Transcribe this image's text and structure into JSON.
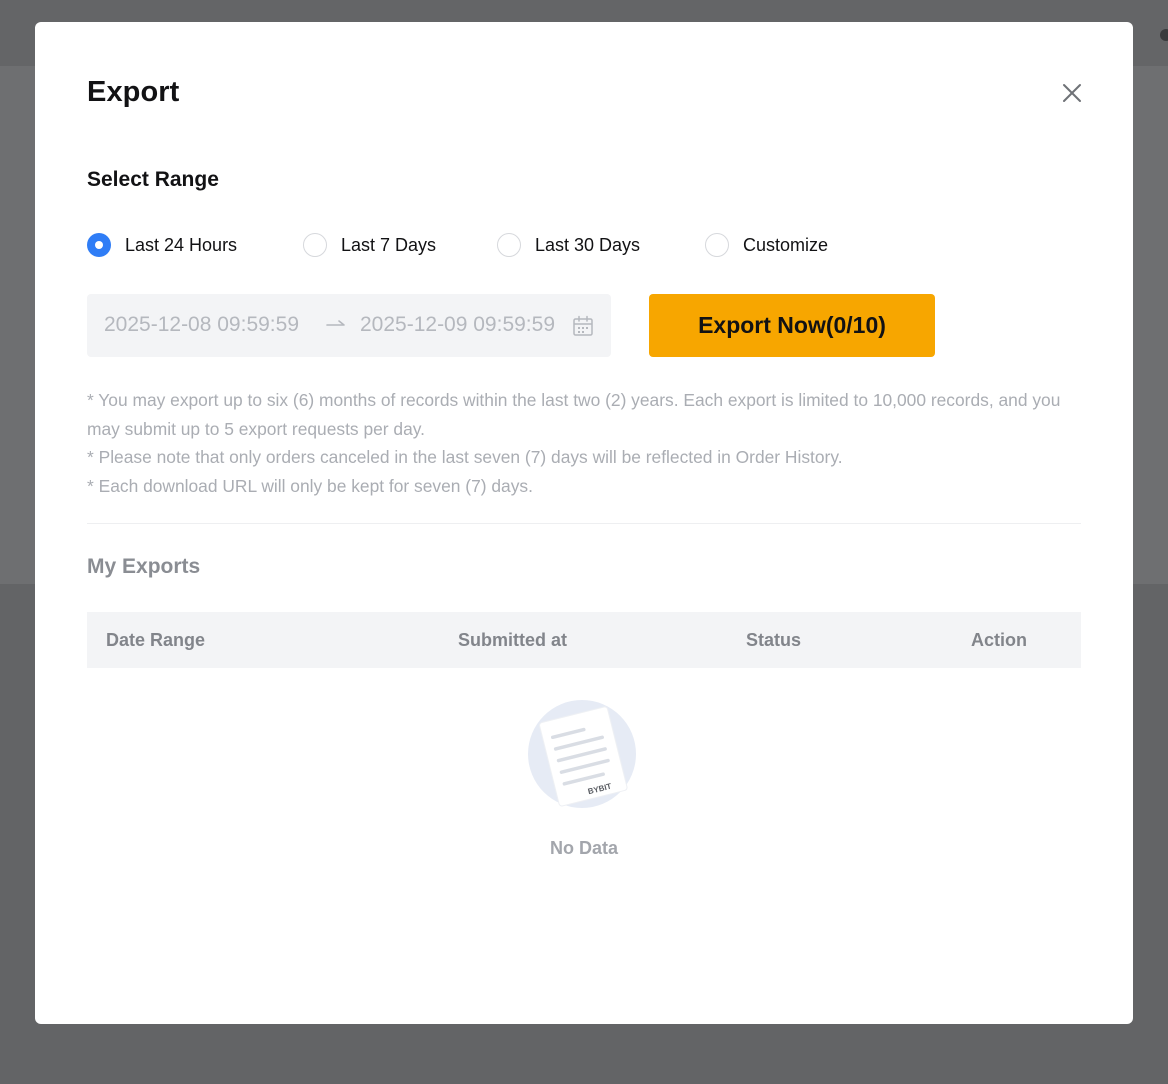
{
  "dialog": {
    "title": "Export",
    "section_label": "Select Range",
    "range_options": [
      {
        "label": "Last 24 Hours",
        "selected": true
      },
      {
        "label": "Last 7 Days",
        "selected": false
      },
      {
        "label": "Last 30 Days",
        "selected": false
      },
      {
        "label": "Customize",
        "selected": false
      }
    ],
    "date_range": {
      "start": "2025-12-08 09:59:59",
      "end": "2025-12-09 09:59:59"
    },
    "export_button_label": "Export Now(0/10)",
    "notes": [
      "* You may export up to six (6) months of records within the last two (2) years. Each export is limited to 10,000 records, and you may submit up to 5 export requests per day.",
      "* Please note that only orders canceled in the last seven (7) days will be reflected in Order History.",
      "* Each download URL will only be kept for seven (7) days."
    ]
  },
  "exports": {
    "title": "My Exports",
    "columns": [
      "Date Range",
      "Submitted at",
      "Status",
      "Action"
    ],
    "rows": [],
    "empty_text": "No Data",
    "empty_logo_text": "BYBIT"
  },
  "icons": {
    "close": "close-icon",
    "arrow": "arrow-right-icon",
    "calendar": "calendar-icon",
    "empty": "empty-document-illustration"
  },
  "colors": {
    "accent": "#f7a600",
    "radio_selected": "#2f7df6",
    "overlay": "#6b6c6e"
  }
}
